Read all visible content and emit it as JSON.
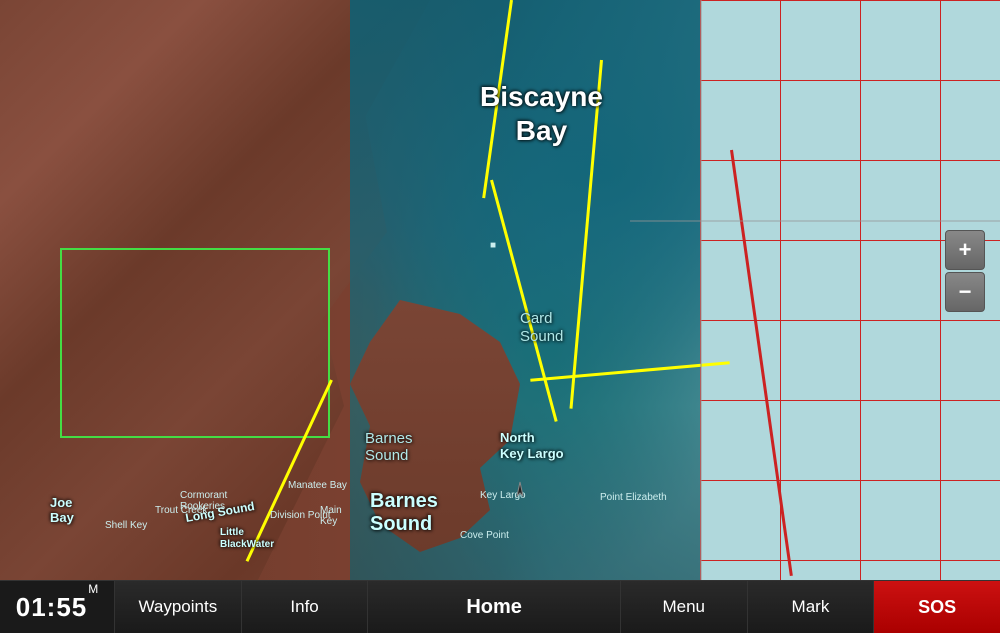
{
  "map": {
    "labels": {
      "biscayne_bay": "Biscayne\nBay",
      "biscayne_line1": "Biscayne",
      "biscayne_line2": "Bay",
      "card_sound": "Card\nSound",
      "barnes_sound_small": "Barnes\nSound",
      "barnes_sound_large": "Barnes\nSound",
      "north_key_largo_line1": "North",
      "north_key_largo_line2": "Key Largo",
      "joe_bay": "Joe\nBay",
      "long_sound": "Long Sound",
      "little_blackwater": "Little\nBlackWater"
    }
  },
  "zoom": {
    "plus_label": "+",
    "minus_label": "−"
  },
  "toolbar": {
    "time": "01:55",
    "ampm": "M",
    "waypoints_label": "Waypoints",
    "info_label": "Info",
    "home_label": "Home",
    "menu_label": "Menu",
    "mark_label": "Mark",
    "sos_label": "SOS"
  }
}
